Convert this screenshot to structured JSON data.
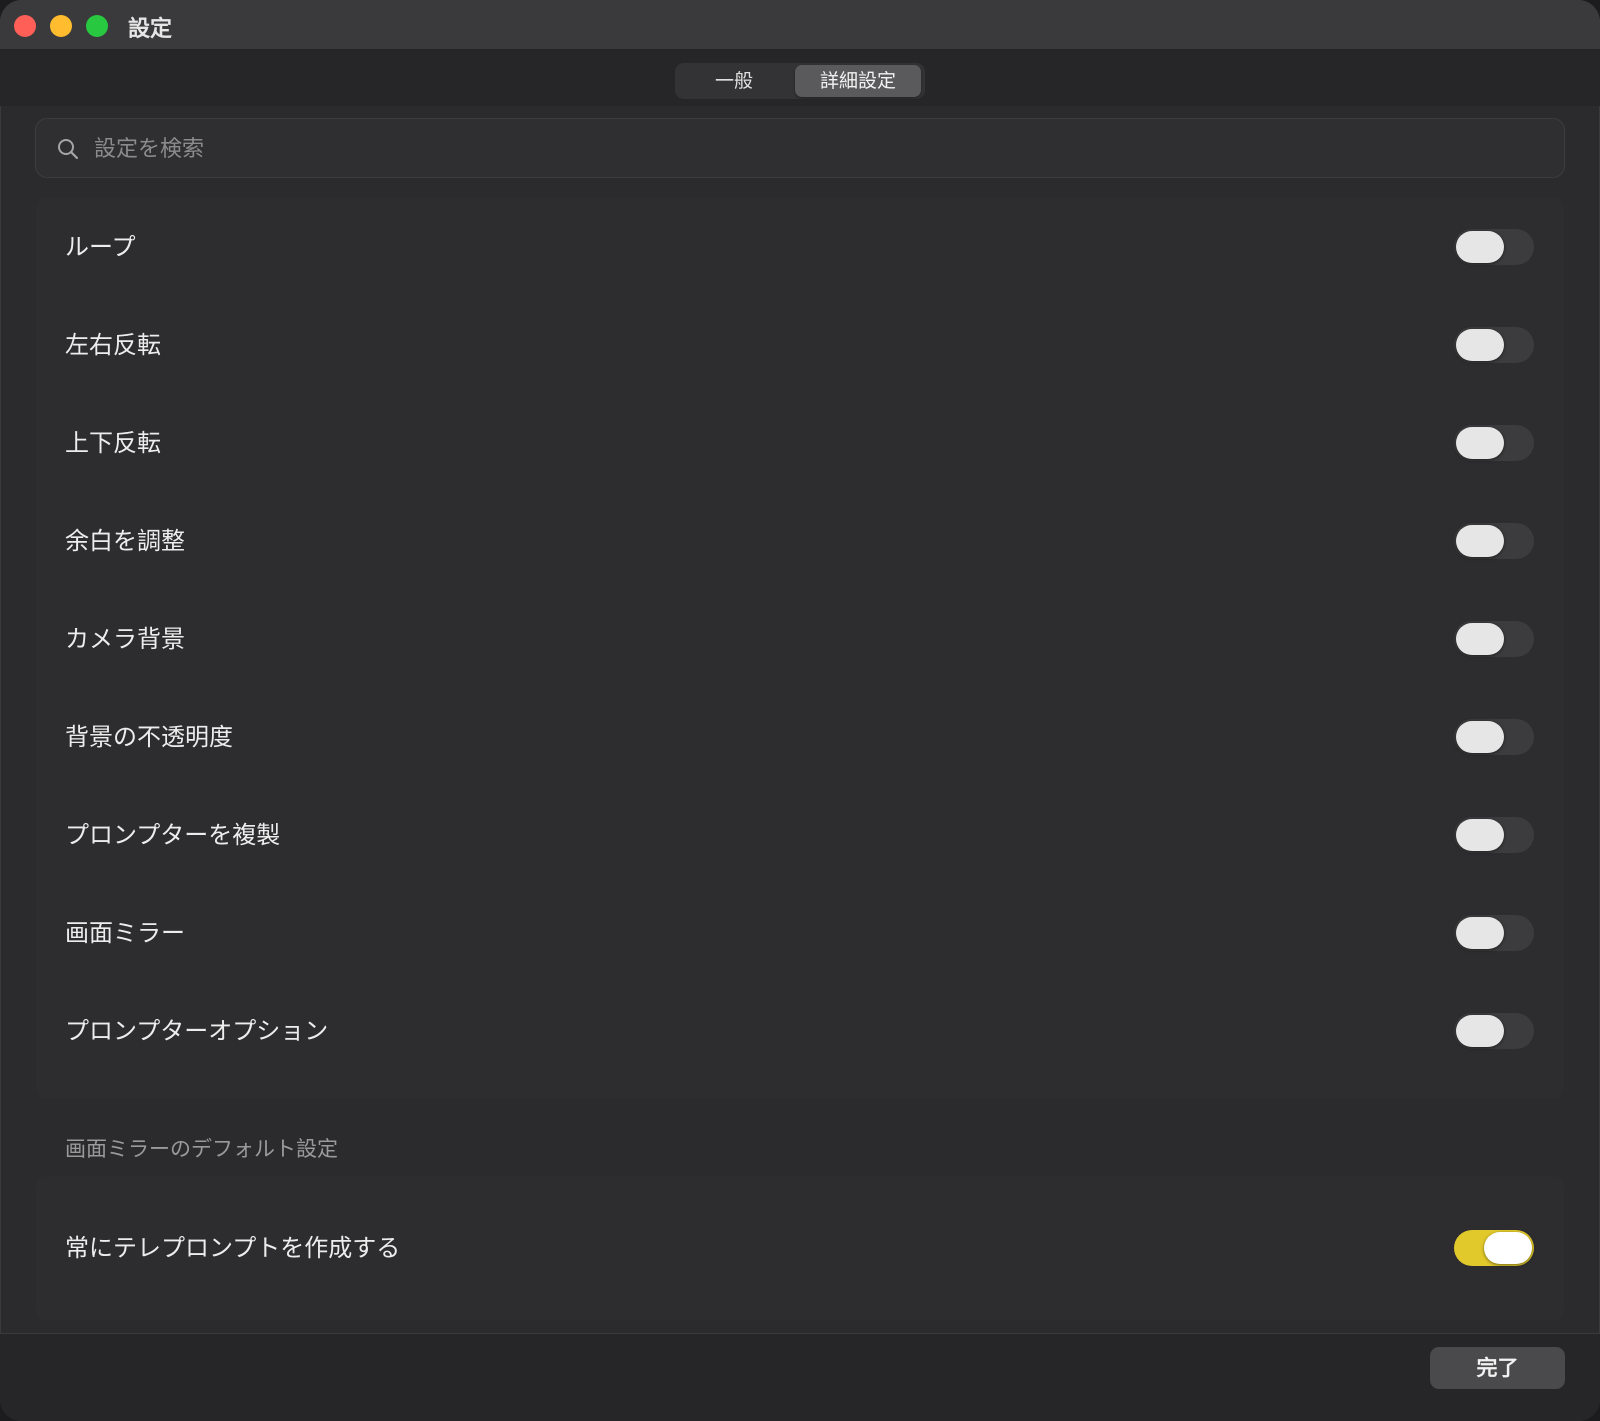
{
  "window": {
    "title": "設定"
  },
  "tabs": [
    {
      "label": "一般",
      "selected": false
    },
    {
      "label": "詳細設定",
      "selected": true
    }
  ],
  "search": {
    "placeholder": "設定を検索",
    "value": ""
  },
  "settings": [
    {
      "label": "ループ",
      "enabled": false
    },
    {
      "label": "左右反転",
      "enabled": false
    },
    {
      "label": "上下反転",
      "enabled": false
    },
    {
      "label": "余白を調整",
      "enabled": false
    },
    {
      "label": "カメラ背景",
      "enabled": false
    },
    {
      "label": "背景の不透明度",
      "enabled": false
    },
    {
      "label": "プロンプターを複製",
      "enabled": false
    },
    {
      "label": "画面ミラー",
      "enabled": false
    },
    {
      "label": "プロンプターオプション",
      "enabled": false
    }
  ],
  "mirror_defaults": {
    "header": "画面ミラーのデフォルト設定",
    "items": [
      {
        "label": "常にテレプロンプトを作成する",
        "enabled": true
      }
    ]
  },
  "footer": {
    "done_label": "完了"
  },
  "colors": {
    "toggle_on": "#e2c92b",
    "close": "#ff5f57",
    "minimize": "#febc2e",
    "maximize": "#28c840"
  },
  "icons": [
    "search-icon",
    "close-button",
    "minimize-button",
    "maximize-button"
  ]
}
